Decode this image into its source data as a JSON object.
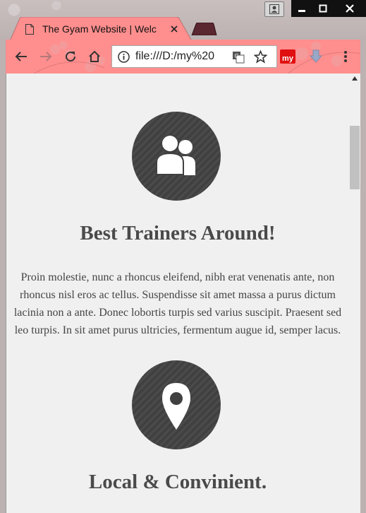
{
  "browser": {
    "tab_title": "The Gyam Website | Welc",
    "address": "file:///D:/my%20",
    "extension_label": "my",
    "accent_color": "#ff8e8e"
  },
  "page": {
    "features": [
      {
        "icon": "users-icon",
        "title": "Best Trainers Around!",
        "text": "Proin molestie, nunc a rhoncus eleifend, nibh erat venenatis ante, non rhoncus nisl eros ac tellus. Suspendisse sit amet massa a purus dictum lacinia non a ante. Donec lobortis turpis sed varius suscipit. Praesent sed leo turpis. In sit amet purus ultricies, fermentum augue id, semper lacus."
      },
      {
        "icon": "map-pin-icon",
        "title": "Local & Convinient."
      }
    ]
  }
}
